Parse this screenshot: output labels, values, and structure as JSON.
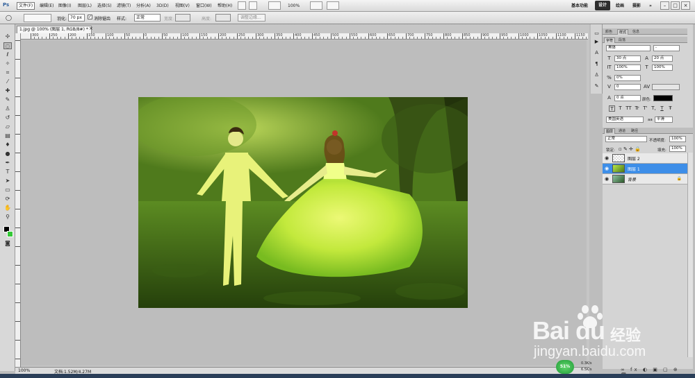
{
  "app": {
    "logo": "Ps",
    "menu": [
      "文件(F)",
      "编辑(E)",
      "图像(I)",
      "图层(L)",
      "选择(S)",
      "滤镜(T)",
      "分析(A)",
      "3D(D)",
      "视图(V)",
      "窗口(W)",
      "帮助(H)"
    ],
    "zoom_select": "100%",
    "workspaces": [
      "基本功能",
      "设计",
      "绘画",
      "摄影"
    ],
    "active_workspace": "设计",
    "more": "»",
    "window_buttons": [
      "–",
      "□",
      "×"
    ]
  },
  "options": {
    "feather_label": "羽化:",
    "feather_value": "70 px",
    "antialias_label": "消除锯齿",
    "style_label": "样式:",
    "style_value": "正常",
    "width_label": "宽度:",
    "height_label": "高度:",
    "refine_button": "调整边缘..."
  },
  "document": {
    "tab_title": "1.jpg @ 100% (图层 1, RGB/8#) *",
    "close": "×",
    "ruler_h": [
      "300",
      "250",
      "200",
      "150",
      "100",
      "50",
      "0",
      "50",
      "100",
      "150",
      "200",
      "250",
      "300",
      "350",
      "400",
      "450",
      "500",
      "550",
      "600",
      "650",
      "700",
      "750",
      "800",
      "850",
      "900",
      "950",
      "1000",
      "1050",
      "1100",
      "1150",
      "1200"
    ],
    "status_zoom": "100%",
    "status_doc": "文档:1.52M/4.27M"
  },
  "character_panel": {
    "tabs": [
      "颜色",
      "样式",
      "信息"
    ],
    "subtabs": [
      "字符",
      "段落"
    ],
    "font_family": "黑体",
    "font_style": "-",
    "font_size": "30 点",
    "leading": "20 点",
    "vscale": "100%",
    "hscale": "100%",
    "tracking_pct": "0%",
    "kerning": "0",
    "baseline": "0 点",
    "color_label": "颜色:",
    "language": "美国英语",
    "antialias": "平滑",
    "text_styles": [
      "T",
      "T",
      "TT",
      "Tr",
      "T'",
      "T,",
      "T",
      "Ŧ"
    ]
  },
  "layers_panel": {
    "tabs": [
      "图层",
      "通道",
      "路径"
    ],
    "blend_mode": "正常",
    "opacity_label": "不透明度:",
    "opacity": "100%",
    "lock_label": "锁定:",
    "fill_label": "填充:",
    "fill": "100%",
    "layers": [
      {
        "name": "图层 2",
        "selected": false
      },
      {
        "name": "图层 1",
        "selected": true
      },
      {
        "name": "背景",
        "selected": false
      }
    ]
  },
  "watermark": {
    "brand": "Bai du",
    "brand_cn": "经验",
    "url": "jingyan.baidu.com"
  },
  "network": {
    "percent": "51%",
    "up": "0.3K/s",
    "down": "6.5K/s"
  }
}
